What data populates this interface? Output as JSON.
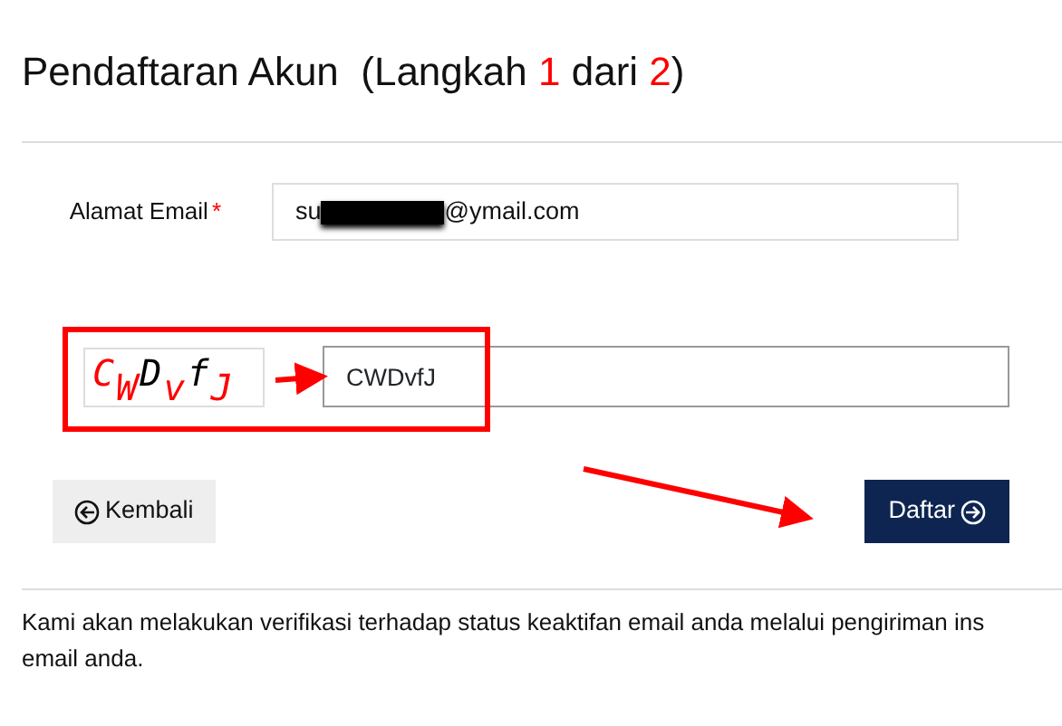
{
  "title": [
    {
      "text": "Pendaftaran Akun  (Langkah ",
      "highlight": false
    },
    {
      "text": "1",
      "highlight": true
    },
    {
      "text": " dari ",
      "highlight": false
    },
    {
      "text": "2",
      "highlight": true
    },
    {
      "text": ")",
      "highlight": false
    }
  ],
  "email": {
    "label": "Alamat Email",
    "required_mark": "*",
    "value_start": "su",
    "redacted": true,
    "value_end": "@ymail.com"
  },
  "captcha": {
    "characters": [
      {
        "char": "C",
        "color": "#ff0000"
      },
      {
        "char": "W",
        "color": "#ff0000"
      },
      {
        "char": "D",
        "color": "#000000"
      },
      {
        "char": "v",
        "color": "#ff0000"
      },
      {
        "char": "f",
        "color": "#000000"
      },
      {
        "char": "J",
        "color": "#ff0000"
      }
    ],
    "value": "CWDvfJ"
  },
  "buttons": [
    {
      "label": "Kembali",
      "kind": "back"
    },
    {
      "label": "Daftar",
      "kind": "submit"
    }
  ],
  "notice": [
    "Kami akan melakukan verifikasi terhadap status keaktifan email anda melalui pengiriman ins",
    "email anda."
  ]
}
